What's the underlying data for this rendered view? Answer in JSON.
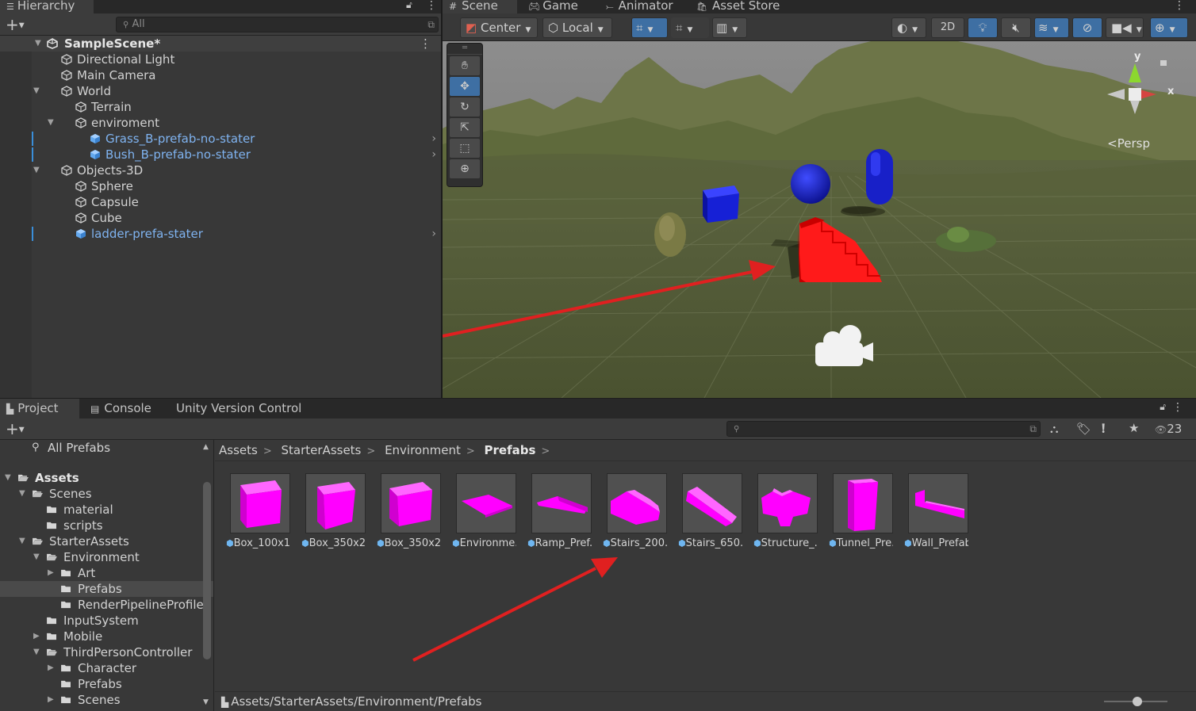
{
  "hierarchy": {
    "tab_label": "Hierarchy",
    "search_placeholder": "All",
    "scene_name": "SampleScene*",
    "items": [
      {
        "label": "Directional Light",
        "prefab": false
      },
      {
        "label": "Main Camera",
        "prefab": false
      },
      {
        "label": "World",
        "prefab": false
      },
      {
        "label": "Terrain",
        "prefab": false
      },
      {
        "label": "enviroment",
        "prefab": false
      },
      {
        "label": "Grass_B-prefab-no-stater",
        "prefab": true
      },
      {
        "label": "Bush_B-prefab-no-stater",
        "prefab": true
      },
      {
        "label": "Objects-3D",
        "prefab": false
      },
      {
        "label": "Sphere",
        "prefab": false
      },
      {
        "label": "Capsule",
        "prefab": false
      },
      {
        "label": "Cube",
        "prefab": false
      },
      {
        "label": "ladder-prefa-stater",
        "prefab": true
      }
    ]
  },
  "scene_tabs": [
    "Scene",
    "Game",
    "Animator",
    "Asset Store"
  ],
  "scene_toolbar": {
    "pivot_label": "Center",
    "space_label": "Local",
    "mode_2d_label": "2D"
  },
  "scene_view": {
    "projection_label": "Persp",
    "gizmo_y": "y",
    "gizmo_x": "x"
  },
  "project": {
    "tabs": [
      "Project",
      "Console",
      "Unity Version Control"
    ],
    "hidden_count": "23",
    "tree": [
      {
        "label": "All Prefabs"
      },
      {
        "label": "Assets"
      },
      {
        "label": "Scenes"
      },
      {
        "label": "material"
      },
      {
        "label": "scripts"
      },
      {
        "label": "StarterAssets"
      },
      {
        "label": "Environment"
      },
      {
        "label": "Art"
      },
      {
        "label": "Prefabs"
      },
      {
        "label": "RenderPipelineProfiles"
      },
      {
        "label": "InputSystem"
      },
      {
        "label": "Mobile"
      },
      {
        "label": "ThirdPersonController"
      },
      {
        "label": "Character"
      },
      {
        "label": "Prefabs"
      },
      {
        "label": "Scenes"
      }
    ],
    "breadcrumb": [
      "Assets",
      "StarterAssets",
      "Environment",
      "Prefabs"
    ],
    "assets": [
      "Box_100x1...",
      "Box_350x2...",
      "Box_350x2...",
      "Environme...",
      "Ramp_Pref...",
      "Stairs_200...",
      "Stairs_650...",
      "Structure_...",
      "Tunnel_Pre...",
      "Wall_Prefab"
    ],
    "status_path": "Assets/StarterAssets/Environment/Prefabs"
  },
  "colors": {
    "prefab_blue": "#7fb3f0",
    "accent_blue": "#3e6fa3",
    "magenta": "#ff00ff",
    "arrow_red": "#e02020"
  }
}
